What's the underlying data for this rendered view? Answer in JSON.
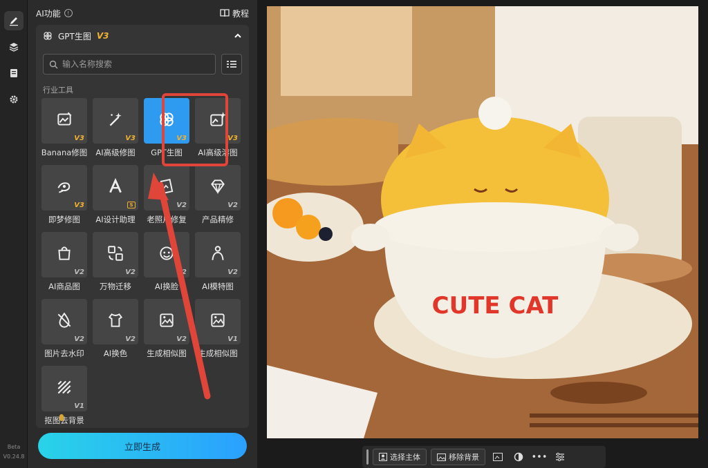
{
  "rail": {
    "items": [
      {
        "name": "brush-icon",
        "active": true
      },
      {
        "name": "layers-icon",
        "active": false
      },
      {
        "name": "document-icon",
        "active": false
      },
      {
        "name": "gear-icon",
        "active": false
      }
    ],
    "beta_label": "Beta",
    "version_label": "V0.24.8"
  },
  "panel": {
    "title": "AI功能",
    "tutorial_label": "教程",
    "tool": {
      "name": "GPT生图",
      "version": "V3"
    },
    "search": {
      "placeholder": "输入名称搜索",
      "value": ""
    },
    "section_label": "行业工具",
    "tools": [
      {
        "label": "Banana修图",
        "version": "V3",
        "icon": "image-edit-icon",
        "ver_color": "gold"
      },
      {
        "label": "AI高级修图",
        "version": "V3",
        "icon": "magic-wand-icon",
        "ver_color": "gold"
      },
      {
        "label": "GPT生图",
        "version": "V3",
        "icon": "gpt-logo-icon",
        "ver_color": "gold",
        "selected": true
      },
      {
        "label": "AI高级溶图",
        "version": "V3",
        "icon": "image-sparkle-icon",
        "ver_color": "gold"
      },
      {
        "label": "即梦修图",
        "version": "V3",
        "icon": "dream-icon",
        "ver_color": "gold"
      },
      {
        "label": "AI设计助理",
        "version": "",
        "icon": "design-a-icon",
        "crown": "S"
      },
      {
        "label": "老照片修复",
        "version": "V2",
        "icon": "photo-restore-icon",
        "ver_color": "grey"
      },
      {
        "label": "产品精修",
        "version": "V2",
        "icon": "diamond-icon",
        "ver_color": "grey"
      },
      {
        "label": "AI商品图",
        "version": "V2",
        "icon": "shopping-bag-icon",
        "ver_color": "grey"
      },
      {
        "label": "万物迁移",
        "version": "V2",
        "icon": "transfer-icon",
        "ver_color": "grey"
      },
      {
        "label": "AI换脸",
        "version": "V2",
        "icon": "face-swap-icon",
        "ver_color": "grey"
      },
      {
        "label": "AI模特图",
        "version": "V2",
        "icon": "model-person-icon",
        "ver_color": "grey"
      },
      {
        "label": "图片去水印",
        "version": "V2",
        "icon": "remove-watermark-icon",
        "ver_color": "grey"
      },
      {
        "label": "AI换色",
        "version": "V2",
        "icon": "recolor-shirt-icon",
        "ver_color": "grey"
      },
      {
        "label": "生成相似图",
        "version": "V2",
        "icon": "similar-image-icon",
        "ver_color": "grey"
      },
      {
        "label": "生成相似图",
        "version": "V1",
        "icon": "similar-image-icon",
        "ver_color": "grey"
      },
      {
        "label": "抠图去背景",
        "version": "V1",
        "icon": "cutout-icon",
        "ver_color": "grey"
      }
    ],
    "generate_label": "立即生成"
  },
  "canvas": {
    "photo_text": "CUTE CAT",
    "toolbar": {
      "select_subject_label": "选择主体",
      "remove_bg_label": "移除背景"
    }
  },
  "colors": {
    "accent": "#2f9bf0",
    "highlight": "#e0453a",
    "gold": "#f0b02e",
    "generate_start": "#29d3e8",
    "generate_end": "#2aa0ff"
  }
}
